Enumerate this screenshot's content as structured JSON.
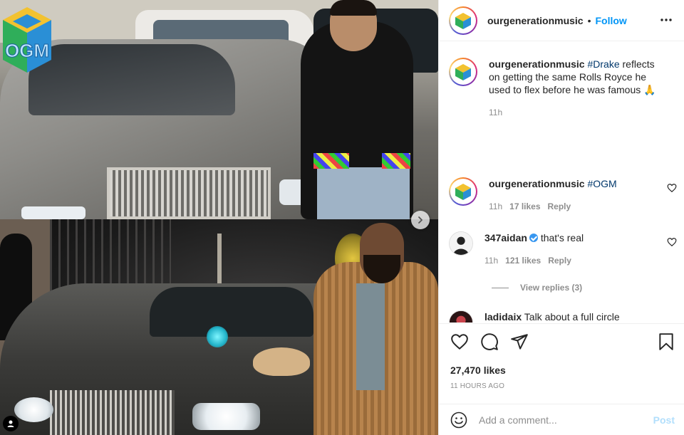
{
  "media": {
    "logo_text": "OGM",
    "carousel_next_icon": "chevron-right-icon",
    "user_tag_icon": "person-tag-icon"
  },
  "header": {
    "username": "ourgenerationmusic",
    "separator": "•",
    "follow_label": "Follow",
    "more_icon": "more-horizontal-icon"
  },
  "caption": {
    "username": "ourgenerationmusic",
    "hashtag": "#Drake",
    "text": " reflects on getting the same Rolls Royce he used to flex before he was famous 🙏",
    "time": "11h"
  },
  "comments": [
    {
      "username": "ourgenerationmusic",
      "hashtag": "#OGM",
      "text": "",
      "time": "11h",
      "likes": "17 likes",
      "reply_label": "Reply"
    },
    {
      "username": "347aidan",
      "verified": true,
      "text": "that's real",
      "time": "11h",
      "likes": "121 likes",
      "reply_label": "Reply",
      "view_replies": "View replies (3)"
    },
    {
      "username": "ladidaix",
      "text": "Talk about a full circle"
    }
  ],
  "actions": {
    "like_icon": "heart-icon",
    "comment_icon": "comment-icon",
    "share_icon": "share-icon",
    "save_icon": "bookmark-icon",
    "likes_count": "27,470 likes",
    "posted_ago": "11 HOURS AGO"
  },
  "add_comment": {
    "emoji_icon": "emoji-icon",
    "placeholder": "Add a comment...",
    "post_label": "Post"
  },
  "colors": {
    "link_blue": "#0095f6",
    "hashtag_navy": "#00376b",
    "muted_gray": "#8e8e8e",
    "post_disabled": "#b2dffc",
    "verified_blue": "#3897f0"
  }
}
